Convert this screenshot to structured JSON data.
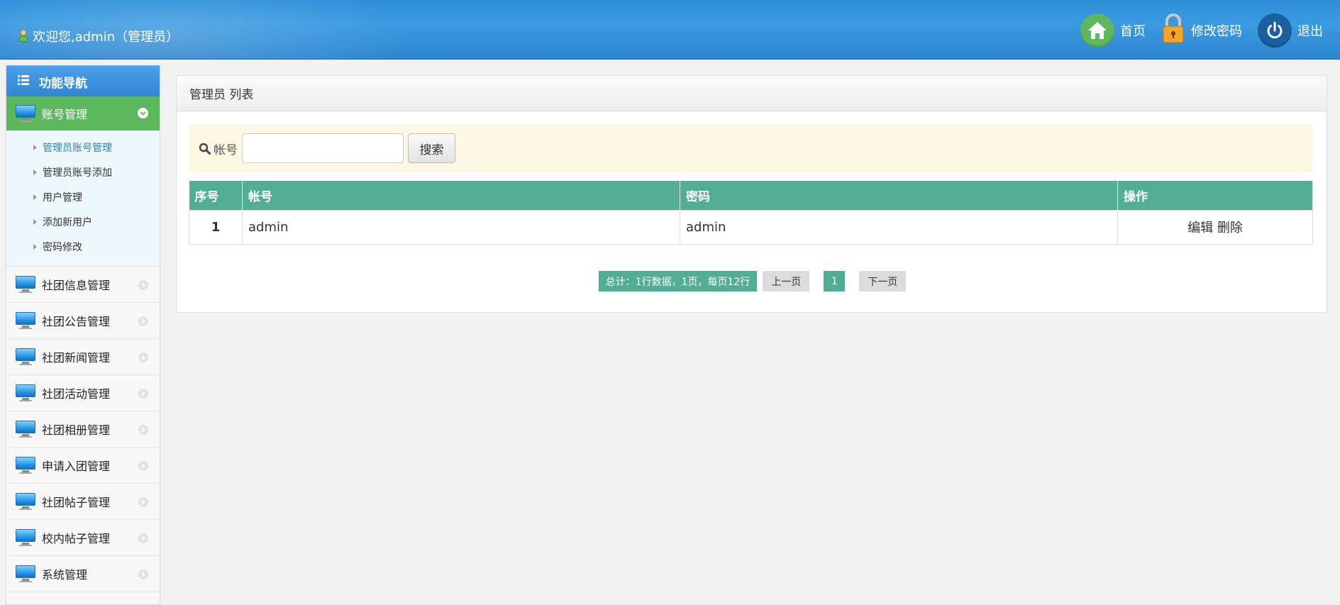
{
  "header": {
    "welcome": "欢迎您,admin（管理员）",
    "actions": [
      {
        "label": "首页"
      },
      {
        "label": "修改密码"
      },
      {
        "label": "退出"
      }
    ]
  },
  "sidebar": {
    "title": "功能导航",
    "active_group": "账号管理",
    "sub_items": [
      {
        "label": "管理员账号管理"
      },
      {
        "label": "管理员账号添加"
      },
      {
        "label": "用户管理"
      },
      {
        "label": "添加新用户"
      },
      {
        "label": "密码修改"
      }
    ],
    "groups": [
      {
        "label": "社团信息管理"
      },
      {
        "label": "社团公告管理"
      },
      {
        "label": "社团新闻管理"
      },
      {
        "label": "社团活动管理"
      },
      {
        "label": "社团相册管理"
      },
      {
        "label": "申请入团管理"
      },
      {
        "label": "社团帖子管理"
      },
      {
        "label": "校内帖子管理"
      },
      {
        "label": "系统管理"
      }
    ]
  },
  "panel": {
    "title": "管理员 列表",
    "search": {
      "label": "帐号",
      "value": "",
      "button": "搜索"
    },
    "columns": [
      "序号",
      "帐号",
      "密码",
      "操作"
    ],
    "rows": [
      {
        "no": "1",
        "account": "admin",
        "password": "admin",
        "edit": "编辑",
        "delete": "删除"
      }
    ],
    "pager": {
      "info": "总计：1行数据，1页，每页12行",
      "prev": "上一页",
      "current": "1",
      "next": "下一页"
    }
  },
  "colors": {
    "header": "#2f86d0",
    "accent_green": "#5cb85c",
    "table_head": "#51ae93",
    "search_bg": "#fcf8e3"
  }
}
